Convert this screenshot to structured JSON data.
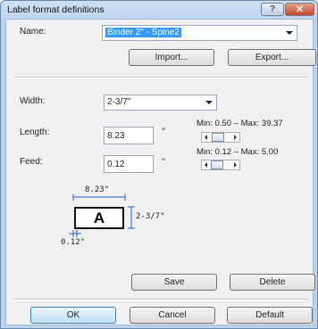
{
  "window": {
    "title": "Label format definitions",
    "help_glyph": "?",
    "close_glyph": "✕"
  },
  "name_row": {
    "label": "Name:",
    "value": "Binder 2\" - Spine2"
  },
  "buttons": {
    "import": "Import...",
    "export": "Export...",
    "save": "Save",
    "delete": "Delete",
    "ok": "OK",
    "cancel": "Cancel",
    "default": "Default"
  },
  "width_row": {
    "label": "Width:",
    "value": "2-3/7\""
  },
  "length_row": {
    "label": "Length:",
    "value": "8.23",
    "unit": "\"",
    "range": "Min: 0.50 – Max: 39.37",
    "slider_position": 0.2
  },
  "feed_row": {
    "label": "Feed:",
    "value": "0.12",
    "unit": "\"",
    "range": "Min: 0.12 – Max: 5.00",
    "slider_position": 0.05
  },
  "preview": {
    "length_label": "8.23\"",
    "width_label": "2-3/7\"",
    "feed_label": "0.12\"",
    "letter": "A"
  },
  "colors": {
    "selection": "#3399ff",
    "dimension_lines": "#1a5fd6",
    "close_button": "#c4452a"
  }
}
